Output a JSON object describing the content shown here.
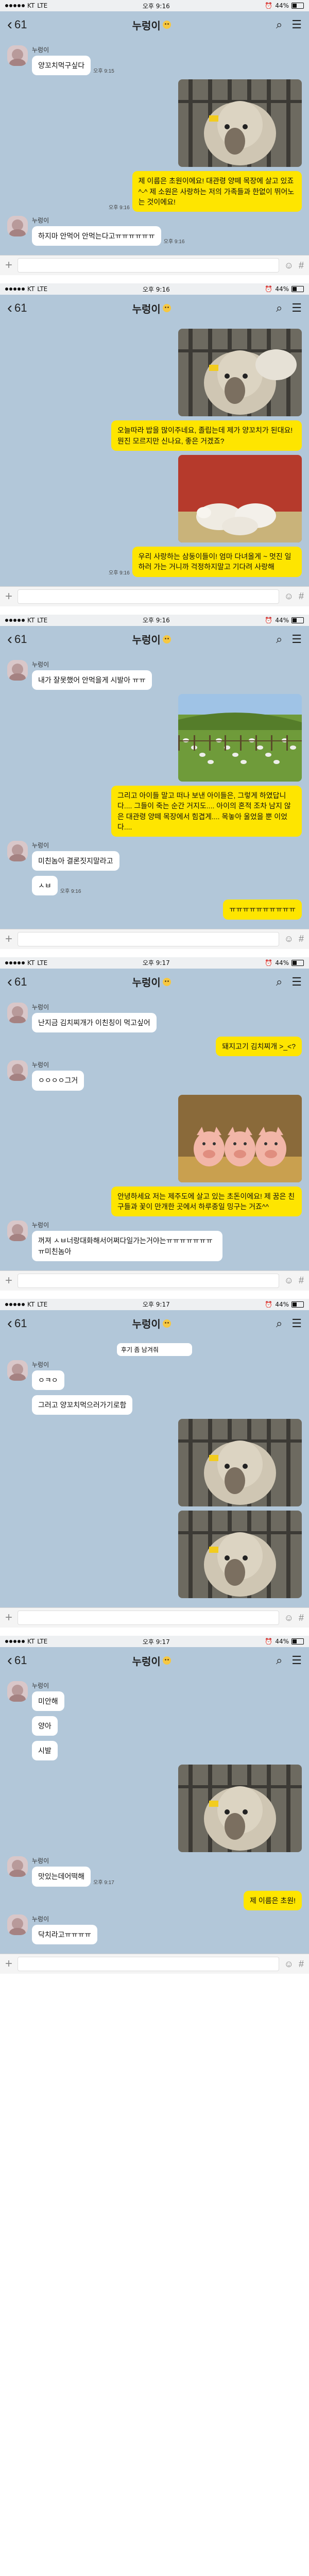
{
  "app": {
    "carrier": "KT",
    "network": "LTE",
    "battery": "44%",
    "unread_count": "61",
    "chat_title": "누렁이",
    "colors": {
      "chat_bg": "#b2c7d9",
      "out_bubble": "#fee500",
      "in_bubble": "#ffffff"
    }
  },
  "screens": [
    {
      "clock": "오후 9:16",
      "messages": [
        {
          "side": "left",
          "sender": "누렁이",
          "text": "양꼬치먹구싶다",
          "time": "오후 9:15"
        },
        {
          "side": "right",
          "photo": "sheep",
          "time": ""
        },
        {
          "side": "right",
          "text": "제 이름은 초원이에요! 대관령 양떼 목장에 살고 있죠 ^-^ 제 소원은 사랑하는 저의 가족들과 한없이 뛰어노는 것이에요!",
          "time": "오후 9:16"
        },
        {
          "side": "left",
          "sender": "누렁이",
          "text": "하지마 안먹어 안먹는다고ㅠㅠㅠㅠㅠㅠ",
          "time": "오후 9:16"
        }
      ]
    },
    {
      "clock": "오후 9:16",
      "messages": [
        {
          "side": "right",
          "photo": "sheep2",
          "time": ""
        },
        {
          "side": "right",
          "text": "오늘따라 밥을 많이주네요, 졸립는데 제가 양꼬치가 된대요! 뭔진 모르지만 신나요, 좋은 거겠죠?",
          "time": ""
        },
        {
          "side": "right",
          "photo": "lambs",
          "time": ""
        },
        {
          "side": "right",
          "text": "우리 사랑하는 삼둥이들이! 엄마 다녀올게 ~ 멋진 일 하러 가는 거니까 걱정하지말고 기다려 사랑해",
          "time": "오후 9:16"
        }
      ]
    },
    {
      "clock": "오후 9:16",
      "messages": [
        {
          "side": "left",
          "sender": "누렁이",
          "text": "내가 잘못했어 안먹을게 시발아 ㅠㅠ",
          "time": ""
        },
        {
          "side": "right",
          "photo": "pasture",
          "time": ""
        },
        {
          "side": "right",
          "text": "그리고 아이들 말고 떠나 보낸 아이들은, 그렇게 하였답니다.... 그들이 죽는 순간 거지도.... 아이의 혼적 조차 남지 않은 대관령 양떼 목장에서 힘겹게.... 목놓아 울었을 뿐 이었다....",
          "time": ""
        },
        {
          "side": "left",
          "sender": "누렁이",
          "text": "미친놈아 결론짓지말라고",
          "time": ""
        },
        {
          "side": "left",
          "sender": "",
          "text": "ㅅㅂ",
          "time": "오후 9:16"
        },
        {
          "side": "right",
          "text": "ㅠㅠㅠㅠㅠㅠㅠㅠㅠㅠ",
          "time": ""
        }
      ]
    },
    {
      "clock": "오후 9:17",
      "messages": [
        {
          "side": "left",
          "sender": "누렁이",
          "text": "난지금 김치찌개가 이친칭이 먹고싶어",
          "time": ""
        },
        {
          "side": "right",
          "text": "돼지고기 김치찌개 >_<?",
          "time": ""
        },
        {
          "side": "left",
          "sender": "누렁이",
          "text": "ㅇㅇㅇㅇ그거",
          "time": ""
        },
        {
          "side": "right",
          "photo": "piglets",
          "time": ""
        },
        {
          "side": "right",
          "text": "안녕하세요 저는 제주도에 살고 있는 초돈이에요! 제 꿈은 친구들과 꽃이 만개한 곳에서 하루종일 밍구는 거죠^^",
          "time": ""
        },
        {
          "side": "left",
          "sender": "누렁이",
          "text": "꺼져 ㅅㅂ너랑대화해서어쩌다일가는거야는ㅠㅠㅠㅠㅠㅠㅠㅠ미친놈아",
          "time": ""
        }
      ]
    },
    {
      "clock": "오후 9:17",
      "banner": "후기 좀 남겨줘",
      "messages": [
        {
          "side": "left",
          "sender": "누렁이",
          "text": "ㅇㅋㅇ",
          "time": ""
        },
        {
          "side": "left",
          "sender": "",
          "text": "그러고 양꼬치먹으러가기로함",
          "time": ""
        },
        {
          "side": "right",
          "photo": "sheep",
          "time": ""
        },
        {
          "side": "right",
          "photo": "sheep",
          "time": ""
        }
      ]
    },
    {
      "clock": "오후 9:17",
      "messages": [
        {
          "side": "left",
          "sender": "누렁이",
          "text": "미안해",
          "time": ""
        },
        {
          "side": "left",
          "sender": "",
          "text": "양아",
          "time": ""
        },
        {
          "side": "left",
          "sender": "",
          "text": "시발",
          "time": ""
        },
        {
          "side": "right",
          "photo": "sheep",
          "time": ""
        },
        {
          "side": "left",
          "sender": "누렁이",
          "text": "맛있는데어떡해",
          "time": "오후 9:17"
        },
        {
          "side": "right",
          "text": "제 이름은 초원!",
          "time": ""
        },
        {
          "side": "left",
          "sender": "누렁이",
          "text": "닥치라고ㅠㅠㅠㅠ",
          "time": ""
        }
      ]
    }
  ]
}
